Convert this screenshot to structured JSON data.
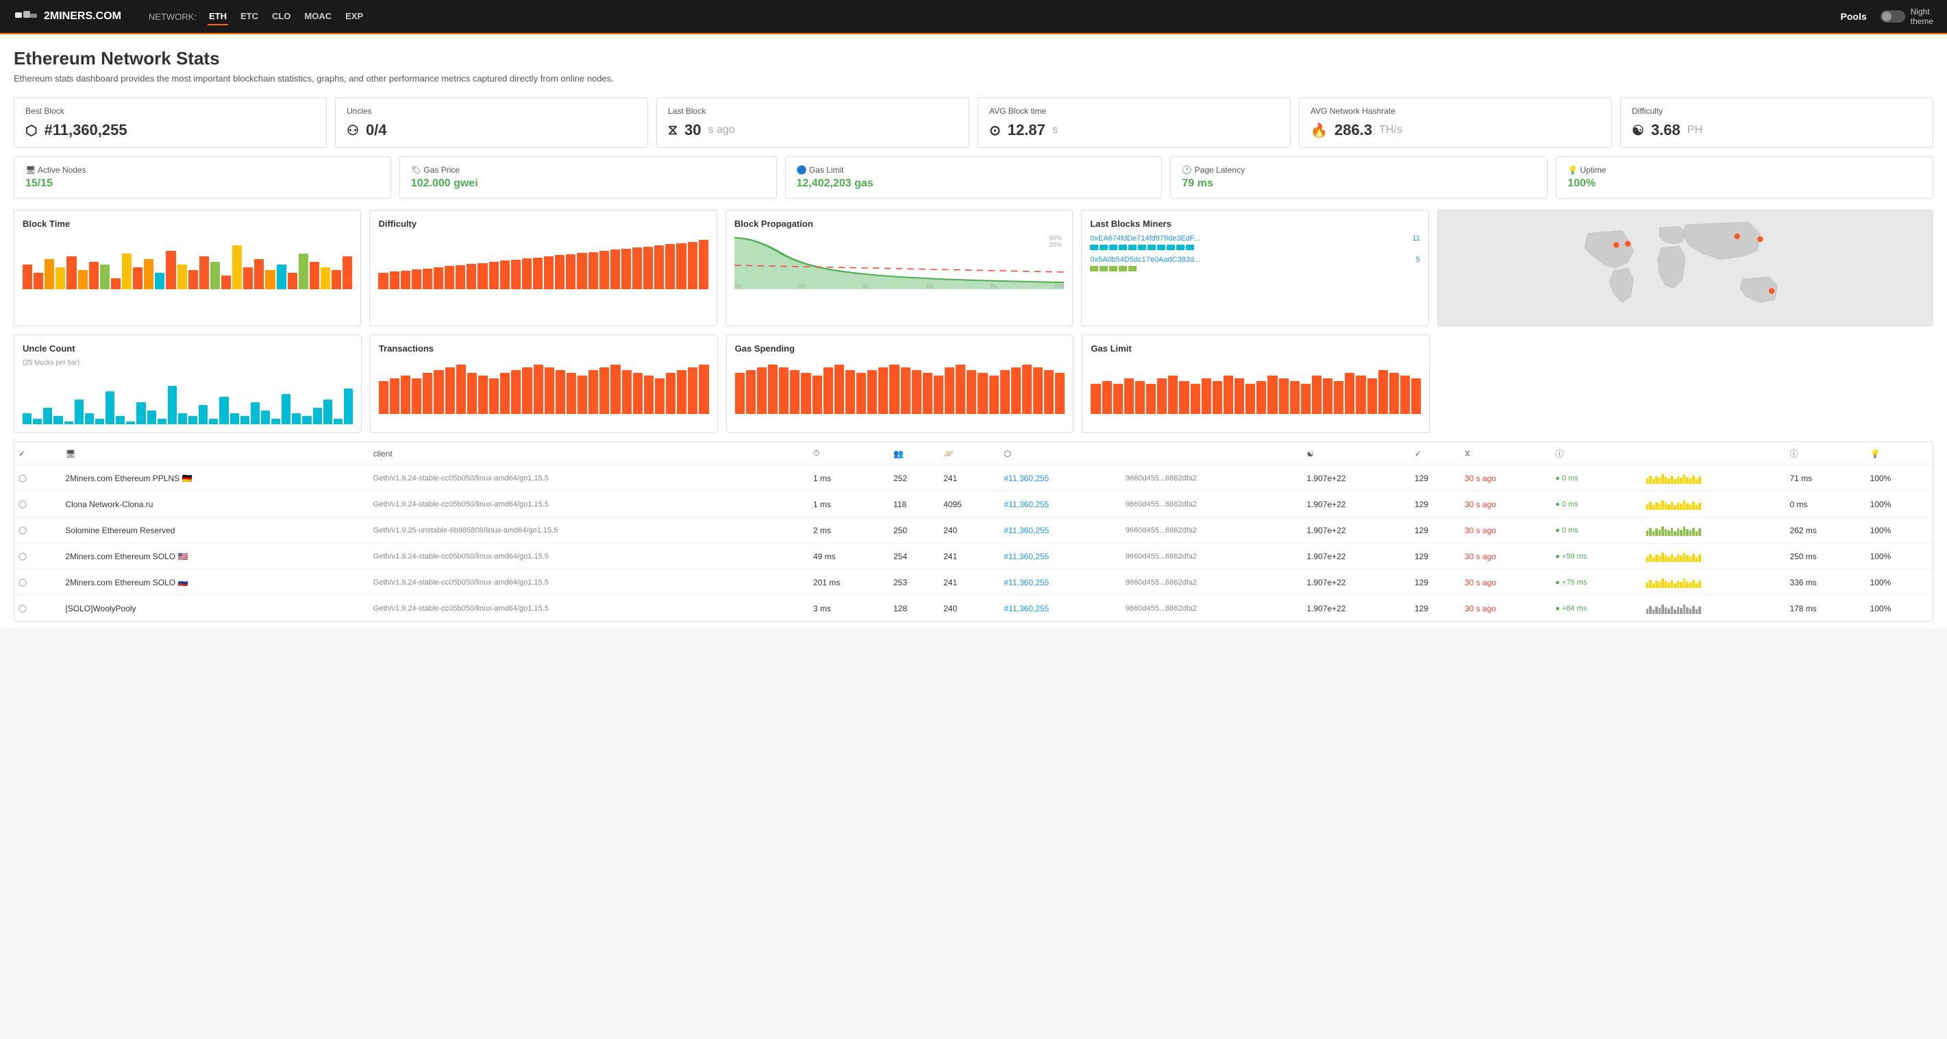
{
  "header": {
    "logo": "2MINERS.COM",
    "nav_label": "NETWORK:",
    "nav_items": [
      "ETH",
      "ETC",
      "CLO",
      "MOAC",
      "EXP"
    ],
    "active_nav": "ETH",
    "pools_label": "Pools",
    "night_theme_label": "Night\ntheme"
  },
  "page": {
    "title": "Ethereum Network Stats",
    "subtitle": "Ethereum stats dashboard provides the most important blockchain statistics, graphs, and other performance metrics captured directly from online nodes."
  },
  "stat_cards": [
    {
      "label": "Best Block",
      "value": "#11,360,255",
      "icon": "□",
      "unit": ""
    },
    {
      "label": "Uncles",
      "value": "0/4",
      "icon": "⚇",
      "unit": ""
    },
    {
      "label": "Last Block",
      "value": "30",
      "unit": "s ago",
      "icon": "⧖"
    },
    {
      "label": "AVG Block time",
      "value": "12.87",
      "unit": "s",
      "icon": "⊙"
    },
    {
      "label": "AVG Network Hashrate",
      "value": "286.3",
      "unit": "TH/s",
      "icon": "🔥"
    },
    {
      "label": "Difficulty",
      "value": "3.68",
      "unit": "PH",
      "icon": "☯"
    }
  ],
  "stat_cards_2": [
    {
      "label": "Active Nodes",
      "value": "15/15",
      "icon": "🖥"
    },
    {
      "label": "Gas Price",
      "value": "102.000 gwei",
      "icon": "🏷"
    },
    {
      "label": "Gas Limit",
      "value": "12,402,203 gas",
      "icon": "🔵"
    },
    {
      "label": "Page Latency",
      "value": "79 ms",
      "icon": "🕐"
    },
    {
      "label": "Uptime",
      "value": "100%",
      "icon": "💡"
    }
  ],
  "chart_panels_row1": [
    {
      "title": "Block Time",
      "color": "#ff5722",
      "type": "block_time"
    },
    {
      "title": "Difficulty",
      "color": "#ff5722",
      "type": "difficulty"
    },
    {
      "title": "Block Propagation",
      "color": "#4caf50",
      "type": "propagation"
    }
  ],
  "chart_panels_row2": [
    {
      "title": "Uncle Count",
      "subtitle": "(25 blocks per bar)",
      "color": "#00bcd4",
      "type": "uncle_count"
    },
    {
      "title": "Transactions",
      "color": "#ff5722",
      "type": "transactions"
    },
    {
      "title": "Gas Spending",
      "color": "#ff5722",
      "type": "gas_spending"
    }
  ],
  "miners": {
    "title": "Last Blocks Miners",
    "items": [
      {
        "address": "0xEA674fdDe714fd979de3EdF...",
        "count": 11,
        "color": "#00bcd4"
      },
      {
        "address": "0x5A0b54D5dc17e0AadC383d...",
        "count": 5,
        "color": "#8bc34a"
      }
    ]
  },
  "nodes": [
    {
      "name": "2Miners.com Ethereum PPLNS 🇩🇪",
      "client": "Geth/v1.9.24-stable-cc05b050/linux-amd64/go1.15.5",
      "latency": "1 ms",
      "peers": "252",
      "pending": "241",
      "block": "#11,360,255",
      "block_hash": "9660d455...6862dfa2",
      "difficulty": "1.907e+22",
      "uncle_count": "129",
      "last_block_time": "30 s ago",
      "propagation": "● 0 ms",
      "prop_color": "#4caf50",
      "sparkline_color": "#ffd600",
      "latency_col": "71 ms",
      "uptime": "100%"
    },
    {
      "name": "Clona Network-Clona.ru",
      "client": "Geth/v1.9.24-stable-cc05b050/linux-amd64/go1.15.5",
      "latency": "1 ms",
      "peers": "118",
      "pending": "4095",
      "block": "#11,360,255",
      "block_hash": "9660d455...6862dfa2",
      "difficulty": "1.907e+22",
      "uncle_count": "129",
      "last_block_time": "30 s ago",
      "propagation": "● 0 ms",
      "prop_color": "#4caf50",
      "sparkline_color": "#9e9e9e",
      "latency_col": "0 ms",
      "uptime": "100%"
    },
    {
      "name": "Solomine Ethereum Reserved",
      "client": "Geth/v1.9.25-unstable-6b985808/linux-amd64/go1.15.5",
      "latency": "2 ms",
      "peers": "250",
      "pending": "240",
      "block": "#11,360,255",
      "block_hash": "9660d455...6862dfa2",
      "difficulty": "1.907e+22",
      "uncle_count": "129",
      "last_block_time": "30 s ago",
      "propagation": "● 0 ms",
      "prop_color": "#4caf50",
      "sparkline_color": "#9e9e9e",
      "latency_col": "262 ms",
      "uptime": "100%"
    },
    {
      "name": "2Miners.com Ethereum SOLO 🇺🇸",
      "client": "Geth/v1.9.24-stable-cc05b050/linux-amd64/go1.15.5",
      "latency": "49 ms",
      "peers": "254",
      "pending": "241",
      "block": "#11,360,255",
      "block_hash": "9660d455...6862dfa2",
      "difficulty": "1.907e+22",
      "uncle_count": "129",
      "last_block_time": "30 s ago",
      "propagation": "● +59 ms",
      "prop_color": "#4caf50",
      "sparkline_color": "#ffd600",
      "latency_col": "250 ms",
      "uptime": "100%"
    },
    {
      "name": "2Miners.com Ethereum SOLO 🇷🇺",
      "client": "Geth/v1.9.24-stable-cc05b050/linux-amd64/go1.15.5",
      "latency": "201 ms",
      "peers": "253",
      "pending": "241",
      "block": "#11,360,255",
      "block_hash": "9660d455...6862dfa2",
      "difficulty": "1.907e+22",
      "uncle_count": "129",
      "last_block_time": "30 s ago",
      "propagation": "● +75 ms",
      "prop_color": "#4caf50",
      "sparkline_color": "#ffd600",
      "latency_col": "336 ms",
      "uptime": "100%"
    },
    {
      "name": "[SOLO]WoolyPooly",
      "client": "Geth/v1.9.24-stable-cc05b050/linux-amd64/go1.15.5",
      "latency": "3 ms",
      "peers": "128",
      "pending": "240",
      "block": "#11,360,255",
      "block_hash": "9660d455...6862dfa2",
      "difficulty": "1.907e+22",
      "uncle_count": "129",
      "last_block_time": "30 s ago",
      "propagation": "● +84 ms",
      "prop_color": "#4caf50",
      "sparkline_color": "#9e9e9e",
      "latency_col": "178 ms",
      "uptime": "100%"
    }
  ],
  "table_headers": {
    "status": "✓",
    "monitor": "🖥",
    "client": "client",
    "stopwatch": "⏱",
    "peers_icon": "👥",
    "planet": "🪐",
    "block": "⬡",
    "difficulty_icon": "☯",
    "check": "✓",
    "hourglass": "⧖",
    "info": "ⓘ",
    "info2": "ⓘ",
    "light": "💡"
  },
  "colors": {
    "orange": "#ff6600",
    "green": "#4caf50",
    "blue": "#2196f3",
    "red": "#f44336",
    "cyan": "#00bcd4",
    "yellow": "#ffd600",
    "chart_orange": "#ff5722",
    "chart_cyan": "#00bcd4"
  }
}
